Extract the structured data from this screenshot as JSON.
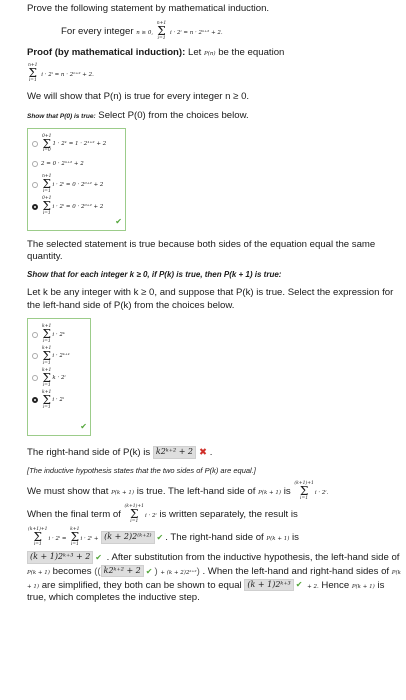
{
  "problem": {
    "prompt": "Prove the following statement by mathematical induction.",
    "statement_prefix": "For every integer",
    "statement_cond": "n ≥ 0,",
    "statement_eq": "i · 2ⁱ = n · 2ⁿ⁺² + 2."
  },
  "proof": {
    "heading": "Proof (by mathematical induction):",
    "let_text": "Let",
    "pn": "P(n)",
    "be_eq": "be the equation",
    "eq": "i · 2ⁱ = n · 2ⁿ⁺² + 2.",
    "show_text": "We will show that P(n) is true for every integer n ≥ 0.",
    "show_p0_label": "Show that P(0) is true:",
    "show_p0_prompt": "Select P(0) from the choices below."
  },
  "choices1": [
    {
      "expr": "1 · 2¹ = 1 · 2¹⁺² + 2",
      "selected": false
    },
    {
      "expr": "2 = 0 · 2ⁿ⁺² + 2",
      "selected": false
    },
    {
      "expr": "i · 2ⁱ = 0 · 2⁰⁺² + 2",
      "selected": false
    },
    {
      "expr": "i · 2ⁱ = 0 · 2⁰⁺² + 2",
      "selected": true
    }
  ],
  "after_p0": "The selected statement is true because both sides of the equation equal the same quantity.",
  "inductive_label": "Show that for each integer k ≥ 0, if P(k) is true, then P(k + 1) is true:",
  "let_k": "Let k be any integer with k ≥ 0, and suppose that P(k) is true. Select the expression for the left-hand side of P(k) from the choices below.",
  "choices2": [
    {
      "expr": "i · 2ᵏ",
      "selected": false
    },
    {
      "expr": "i · 2ᵏ⁺¹",
      "selected": false
    },
    {
      "expr": "k · 2ⁱ",
      "selected": false
    },
    {
      "expr": "i · 2ⁱ",
      "selected": true
    }
  ],
  "rhs_text": "The right-hand side of P(k) is",
  "rhs_answer": "k2ᵏ⁺² + 2",
  "hypothesis_note": "[The inductive hypothesis states that the two sides of P(k) are equal.]",
  "must_show_1": "We must show that",
  "must_show_2": "is true. The left-hand side of",
  "must_show_3": "is",
  "pk1": "P(k + 1)",
  "final_term_1": "When the final term of",
  "final_term_2": "is written separately, the result is",
  "final_box": "(k + 2)2⁽ᵏ⁺²⁾",
  "rhs_of_text": "The right-hand side of",
  "rhs_is": "is",
  "rhs_box": "(k + 1)2ᵏ⁺³ + 2",
  "after_sub": ". After substitution from the inductive hypothesis, the left-hand side of",
  "becomes": "becomes",
  "becomes_box": "k2ᵏ⁺² + 2",
  "becomes_tail": "+ (k + 2)2ᵏ⁺²",
  "when_text": ". When the left-hand and right-hand sides of",
  "simplified": "are simplified, they both can be shown to equal",
  "equal_box": "(k + 1)2ᵏ⁺³",
  "plus_two": "+ 2.",
  "hence": "Hence",
  "completes": "is true, which completes the inductive step."
}
